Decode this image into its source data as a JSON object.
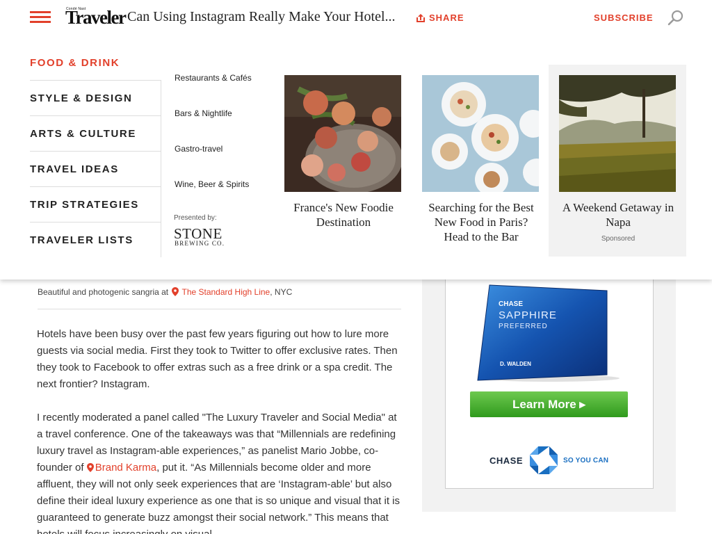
{
  "header": {
    "logo_small": "Condé Nast",
    "logo_big": "Traveler",
    "article_title": "Can Using Instagram Really Make Your Hotel...",
    "share_label": "SHARE",
    "subscribe_label": "SUBSCRIBE"
  },
  "menu": {
    "categories": [
      {
        "label": "FOOD & DRINK"
      },
      {
        "label": "STYLE & DESIGN"
      },
      {
        "label": "ARTS & CULTURE"
      },
      {
        "label": "TRAVEL IDEAS"
      },
      {
        "label": "TRIP STRATEGIES"
      },
      {
        "label": "TRAVELER LISTS"
      }
    ],
    "subcategories": [
      {
        "label": "Restaurants & Cafés"
      },
      {
        "label": "Bars & Nightlife"
      },
      {
        "label": "Gastro-travel"
      },
      {
        "label": "Wine, Beer & Spirits"
      }
    ],
    "presented_by": "Presented by:",
    "sponsor_name": "STONE",
    "sponsor_sub": "BREWING CO.",
    "cards": [
      {
        "caption": "France's New Foodie Destination"
      },
      {
        "caption": "Searching for the Best New Food in Paris? Head to the Bar"
      },
      {
        "caption": "A Weekend Getaway in Napa",
        "sponsored": "Sponsored"
      }
    ]
  },
  "article": {
    "caption_text": "Beautiful and photogenic sangria at",
    "caption_link": "The Standard High Line",
    "caption_suffix": ", NYC",
    "paragraph1": "Hotels have been busy over the past few years figuring out how to lure more guests via social media. First they took to Twitter to offer exclusive rates. Then they took to Facebook to offer extras such as a free drink or a spa credit. The next frontier? Instagram.",
    "paragraph2_start": "I recently moderated a panel called \"The Luxury Traveler and Social Media\" at a travel conference. One of the takeaways was that “Millennials are redefining luxury travel as Instagram-able experiences,” as panelist Mario Jobbe, co-founder of",
    "paragraph2_link": "Brand Karma",
    "paragraph2_end": ", put it. “As Millennials become older and more affluent, they will not only seek experiences that are ‘Instagram-able’ but also define their ideal luxury experience as one that is so unique and visual that it is guaranteed to generate buzz amongst their social network.” This means that hotels will focus increasingly on visual"
  },
  "ad": {
    "card_brand": "CHASE",
    "card_product_1": "SAPPHIRE",
    "card_product_2": "PREFERRED",
    "card_holder": "D. WALDEN",
    "button_label": "Learn More ▸",
    "logo_word": "CHASE",
    "tagline": "SO YOU CAN"
  },
  "colors": {
    "accent": "#e2402b",
    "ad_button": "#3aa325",
    "chase_blue": "#1a6fc1"
  }
}
